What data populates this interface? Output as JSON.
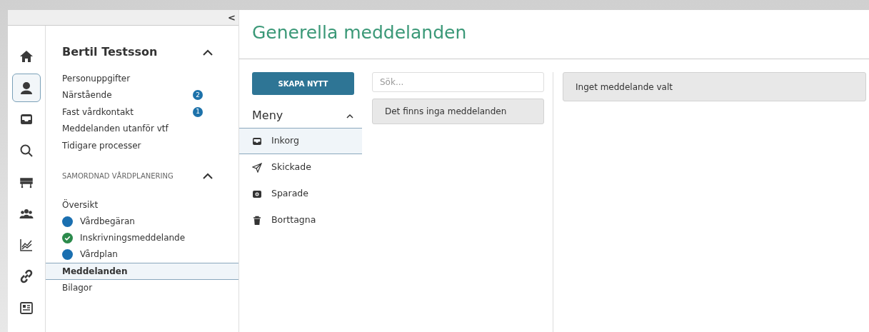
{
  "rail": [
    {
      "selected": false
    },
    {
      "selected": true
    },
    {
      "selected": false
    },
    {
      "selected": false
    },
    {
      "selected": false
    },
    {
      "selected": false
    },
    {
      "selected": false
    },
    {
      "selected": false
    },
    {
      "selected": false
    }
  ],
  "collapse": "<",
  "patient": {
    "name": "Bertil Testsson",
    "expanded": true,
    "items": [
      {
        "label": "Personuppgifter"
      },
      {
        "label": "Närstående",
        "badge": "2"
      },
      {
        "label": "Fast vårdkontakt",
        "badge": "1"
      },
      {
        "label": "Meddelanden utanför vtf"
      },
      {
        "label": "Tidigare processer"
      }
    ]
  },
  "section": {
    "title": "SAMORDNAD VÅRDPLANERING",
    "expanded": true,
    "items": [
      {
        "label": "Översikt",
        "kind": "plain",
        "selected": false
      },
      {
        "label": "Vårdbegäran",
        "kind": "dot",
        "color": "#1a6fb0",
        "selected": false
      },
      {
        "label": "Inskrivningsmeddelande",
        "kind": "check",
        "color": "#2b8a4b",
        "selected": false
      },
      {
        "label": "Vårdplan",
        "kind": "dot",
        "color": "#1a6fb0",
        "selected": false
      },
      {
        "label": "Meddelanden",
        "kind": "plain",
        "selected": true
      },
      {
        "label": "Bilagor",
        "kind": "plain",
        "selected": false
      }
    ]
  },
  "page_title": "Generella meddelanden",
  "create_button": "SKAPA NYTT",
  "menu": {
    "title": "Meny",
    "expanded": true,
    "items": [
      {
        "label": "Inkorg",
        "selected": true
      },
      {
        "label": "Skickade",
        "selected": false
      },
      {
        "label": "Sparade",
        "selected": false
      },
      {
        "label": "Borttagna",
        "selected": false
      }
    ]
  },
  "search": {
    "placeholder": "Sök..."
  },
  "list_empty": "Det finns inga meddelanden",
  "detail_empty": "Inget meddelande valt"
}
